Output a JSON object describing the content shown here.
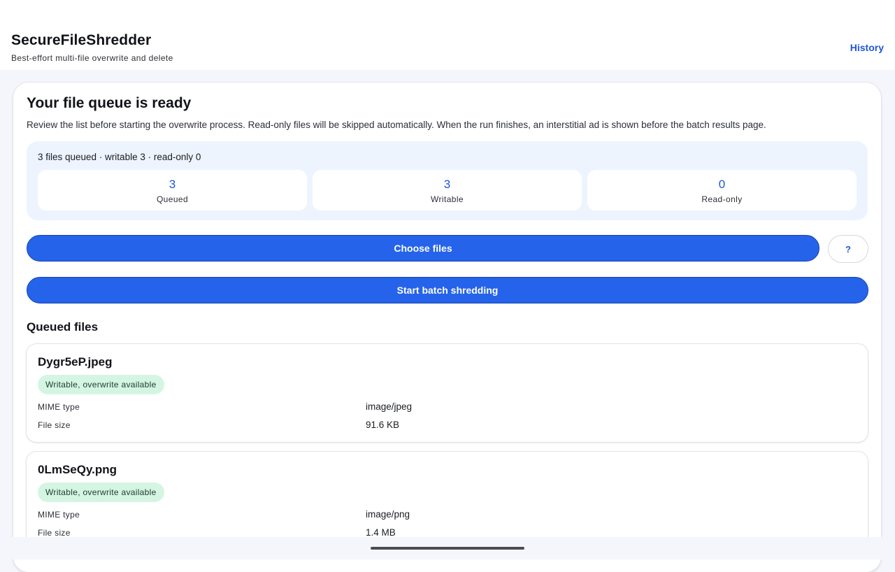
{
  "app": {
    "title": "SecureFileShredder",
    "subtitle": "Best-effort multi-file overwrite and delete",
    "history_label": "History"
  },
  "queue": {
    "title": "Your file queue is ready",
    "description": "Review the list before starting the overwrite process. Read-only files will be skipped automatically. When the run finishes, an interstitial ad is shown before the batch results page.",
    "summary_line": "3 files queued · writable 3 · read-only 0",
    "stats": [
      {
        "value": "3",
        "label": "Queued"
      },
      {
        "value": "3",
        "label": "Writable"
      },
      {
        "value": "0",
        "label": "Read-only"
      }
    ],
    "choose_files_label": "Choose files",
    "help_label": "?",
    "start_label": "Start batch shredding",
    "section_title": "Queued files"
  },
  "files": [
    {
      "name": "Dygr5eP.jpeg",
      "status": "Writable, overwrite available",
      "mime_label": "MIME type",
      "mime_value": "image/jpeg",
      "size_label": "File size",
      "size_value": "91.6 KB"
    },
    {
      "name": "0LmSeQy.png",
      "status": "Writable, overwrite available",
      "mime_label": "MIME type",
      "mime_value": "image/png",
      "size_label": "File size",
      "size_value": "1.4 MB"
    }
  ],
  "colors": {
    "accent": "#2563eb",
    "link": "#1f57d6",
    "badge_bg": "#d5f5e3",
    "summary_bg": "#eef4fe"
  }
}
